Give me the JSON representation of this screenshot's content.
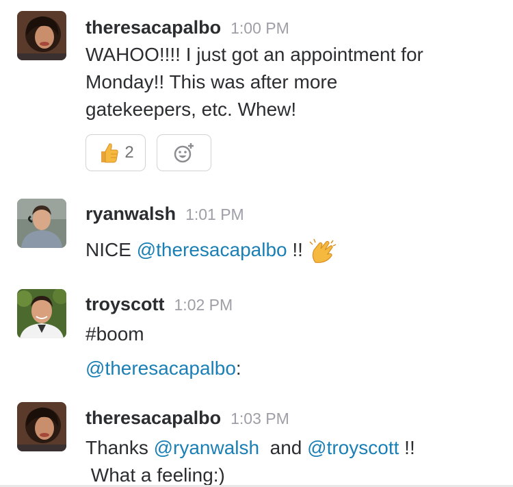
{
  "messages": [
    {
      "author": "theresacapalbo",
      "time": "1:00 PM",
      "lines": [
        "WAHOO!!!!   I just got an appointment for",
        "Monday!!   This was after more",
        "gatekeepers, etc.  Whew!"
      ],
      "reactions": [
        {
          "emoji": "thumbs-up-icon",
          "count": "2"
        },
        {
          "emoji": "add-reaction-icon"
        }
      ]
    },
    {
      "author": "ryanwalsh",
      "time": "1:01 PM",
      "text_prefix": "NICE ",
      "mention": "@theresacapalbo",
      "text_suffix": " !! ",
      "emoji": "clapping-hands-icon"
    },
    {
      "author": "troyscott",
      "time": "1:02 PM",
      "line1": "#boom",
      "mention": "@theresacapalbo",
      "mention_suffix": ":"
    },
    {
      "author": "theresacapalbo",
      "time": "1:03 PM",
      "text_prefix": "Thanks ",
      "mention1": "@ryanwalsh",
      "text_mid": "  and ",
      "mention2": "@troyscott",
      "text_suffix": " !!",
      "line2": " What a feeling:)"
    }
  ],
  "colors": {
    "link": "#1a7fb5",
    "timestamp": "#9e9ea6",
    "author": "#2c2d30",
    "reaction_border": "#d3d3d6"
  }
}
